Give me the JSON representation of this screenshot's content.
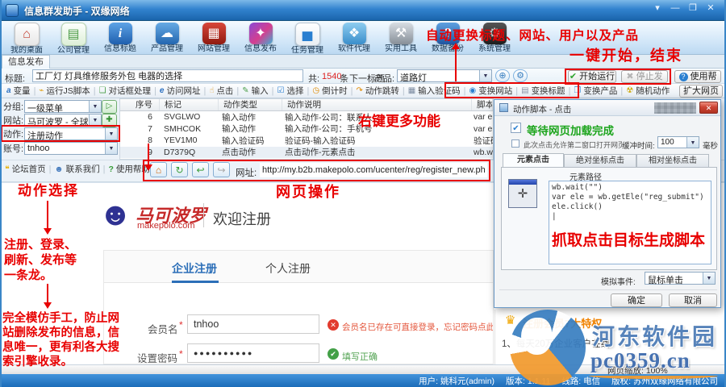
{
  "colors": {
    "annotation_red": "#e80000",
    "brand_red": "#c62a2a",
    "success_green": "#2ea52e",
    "error_icon_red": "#e23b2e",
    "error_text_orange": "#e4573d",
    "privilege_orange": "#f08200",
    "titlebar_blue": "#2f7fc7"
  },
  "window": {
    "title": "信息群发助手 - 双缘网络",
    "menu_glyph": "▾",
    "min_glyph": "—",
    "max_glyph": "❐",
    "close_glyph": "✕"
  },
  "toolbar": {
    "items": [
      {
        "label": "我的桌面",
        "glyph": "⌂"
      },
      {
        "label": "公司管理",
        "glyph": "▤"
      },
      {
        "label": "信息标题",
        "glyph": "i"
      },
      {
        "label": "产品管理",
        "glyph": "☁"
      },
      {
        "label": "网站管理",
        "glyph": "▦"
      },
      {
        "label": "信息发布",
        "glyph": "✦"
      },
      {
        "label": "任务管理",
        "glyph": "▅"
      },
      {
        "label": "软件代理",
        "glyph": "❖"
      },
      {
        "label": "实用工具",
        "glyph": "⚒"
      },
      {
        "label": "数据备份",
        "glyph": "?"
      },
      {
        "label": "系统管理",
        "glyph": "⚙"
      }
    ]
  },
  "tabs": {
    "active": "信息发布"
  },
  "title_row": {
    "label": "标题:",
    "value": "工厂灯 灯具维修服务外包 电器的选择",
    "count_label": "共:",
    "count_value": "1540",
    "count_unit": "条",
    "next_label": "下一标题",
    "product_label": "产品:",
    "product_value": "道路灯",
    "add_glyph": "⊕",
    "settings_glyph": "⚙",
    "start_glyph": "✔",
    "start_label": "开始运行",
    "stop_glyph": "✖",
    "stop_label": "停止发布",
    "help_glyph": "?",
    "help_label": "使用帮助"
  },
  "action_toolbar": {
    "items": [
      {
        "label": "变量",
        "glyph": "a"
      },
      {
        "label": "运行JS脚本",
        "glyph": "⌁"
      },
      {
        "label": "对话框处理",
        "glyph": "❏"
      },
      {
        "label": "访问网址",
        "glyph": "e"
      },
      {
        "label": "点击",
        "glyph": "☝"
      },
      {
        "label": "输入",
        "glyph": "✎"
      },
      {
        "label": "选择",
        "glyph": "☑"
      },
      {
        "label": "倒计时",
        "glyph": "◷"
      },
      {
        "label": "动作跳转",
        "glyph": "↷"
      },
      {
        "label": "输入验证码",
        "glyph": "▦"
      },
      {
        "label": "变换网站",
        "glyph": "◉"
      },
      {
        "label": "变换标题",
        "glyph": "▤"
      },
      {
        "label": "变换产品",
        "glyph": "❒"
      },
      {
        "label": "随机动作",
        "glyph": "☢"
      }
    ],
    "expand_label": "扩大网页"
  },
  "sidebar": {
    "group_label": "分组:",
    "group_value": "一级菜单",
    "play_glyph": "▷",
    "site_label": "网站:",
    "site_value": "马可波罗 - 全球领先",
    "add_glyph": "✚",
    "action_label": "动作:",
    "action_value": "注册动作",
    "account_label": "账号:",
    "account_value": "tnhoo",
    "buttons": [
      {
        "label": "论坛首页",
        "glyph": "❝"
      },
      {
        "label": "联系我们",
        "glyph": "☻"
      },
      {
        "label": "使用帮助",
        "glyph": "?"
      }
    ]
  },
  "table": {
    "headers": [
      "序号",
      "标记",
      "动作类型",
      "动作说明",
      "脚本命令"
    ],
    "rows": [
      {
        "no": "6",
        "tag": "SVGLWO",
        "type": "输入动作",
        "desc": "输入动作-公司：联系人",
        "script": "var ele"
      },
      {
        "no": "7",
        "tag": "SMHCOK",
        "type": "输入动作",
        "desc": "输入动作-公司：手机号",
        "script": "var ele"
      },
      {
        "no": "8",
        "tag": "YEV1M0",
        "type": "输入验证码",
        "desc": "验证码-输入验证码",
        "script": "验证码"
      },
      {
        "no": "9",
        "tag": "D7379Q",
        "type": "点击动作",
        "desc": "点击动作-元素点击",
        "script": "wb.wa"
      }
    ]
  },
  "urlbar": {
    "home_glyph": "⌂",
    "refresh_glyph": "↻",
    "back_glyph": "↩",
    "forward_glyph": "↪",
    "label": "网址:",
    "value": "http://my.b2b.makepolo.com/ucenter/reg/register_new.php"
  },
  "page": {
    "logo_glyph": "☻",
    "brand": "马可波罗",
    "brand_domain": "makepolo.com",
    "welcome": "欢迎注册",
    "tab_company": "企业注册",
    "tab_personal": "个人注册",
    "member_label": "会员名",
    "required_mark": "*",
    "member_value": "tnhoo",
    "member_error_glyph": "✕",
    "member_error": "会员名已存在可直接登录，忘记密码点此处找回",
    "password_label": "设置密码",
    "password_value": "●●●●●●●●●●",
    "password_ok_glyph": "✔",
    "password_ok": "填写正确",
    "crown_glyph": "♛",
    "privileges_title": "注册会员7大特权",
    "privilege_1": "1、每天20万企业客户在线"
  },
  "dialog": {
    "title": "动作脚本 - 点击",
    "close_glyph": "✕",
    "check_glyph": "✔",
    "wait_check": "等待网页加载完成",
    "second_window": "此次点击允许第二窗口打开网页",
    "buffer_label": "缓冲时间:",
    "buffer_value": "100",
    "buffer_unit": "毫秒",
    "tab_element": "元素点击",
    "tab_absolute": "绝对坐标点击",
    "tab_relative": "相对坐标点击",
    "path_label": "元素路径",
    "target_glyph": "✛",
    "code_line1": "wb.wait(\"\")",
    "code_line2": "var ele = wb.getEle(\"reg_submit\")",
    "code_line3": "ele.click()",
    "code_caret": "|",
    "sim_label": "模拟事件:",
    "sim_value": "鼠标单击",
    "ok_label": "确定",
    "cancel_label": "取消"
  },
  "annotations": {
    "auto_replace": "自动更换标题、网站、用户以及产品",
    "one_key": "一键开始，结束",
    "right_click": "右键更多功能",
    "action_select": "动作选择",
    "chain": "注册、登录、刷新、发布等一条龙。",
    "imitate": "完全模仿手工，防止网站删除发布的信息，信息唯一，更有利各大搜索引擎收录。",
    "web_op": "网页操作",
    "grab": "抓取点击目标生成脚本"
  },
  "bottombar": {
    "zoom_label": "网页缩放:",
    "zoom_value": "100%"
  },
  "statusbar": {
    "user": "用户: 姚科元(admin)",
    "version": "版本: 1.1.11",
    "line": "线路: 电信",
    "copyright": "版权: 苏州双缘网络有限公司"
  },
  "watermark": {
    "name": "河东软件园",
    "domain": "pc0359.cn"
  }
}
